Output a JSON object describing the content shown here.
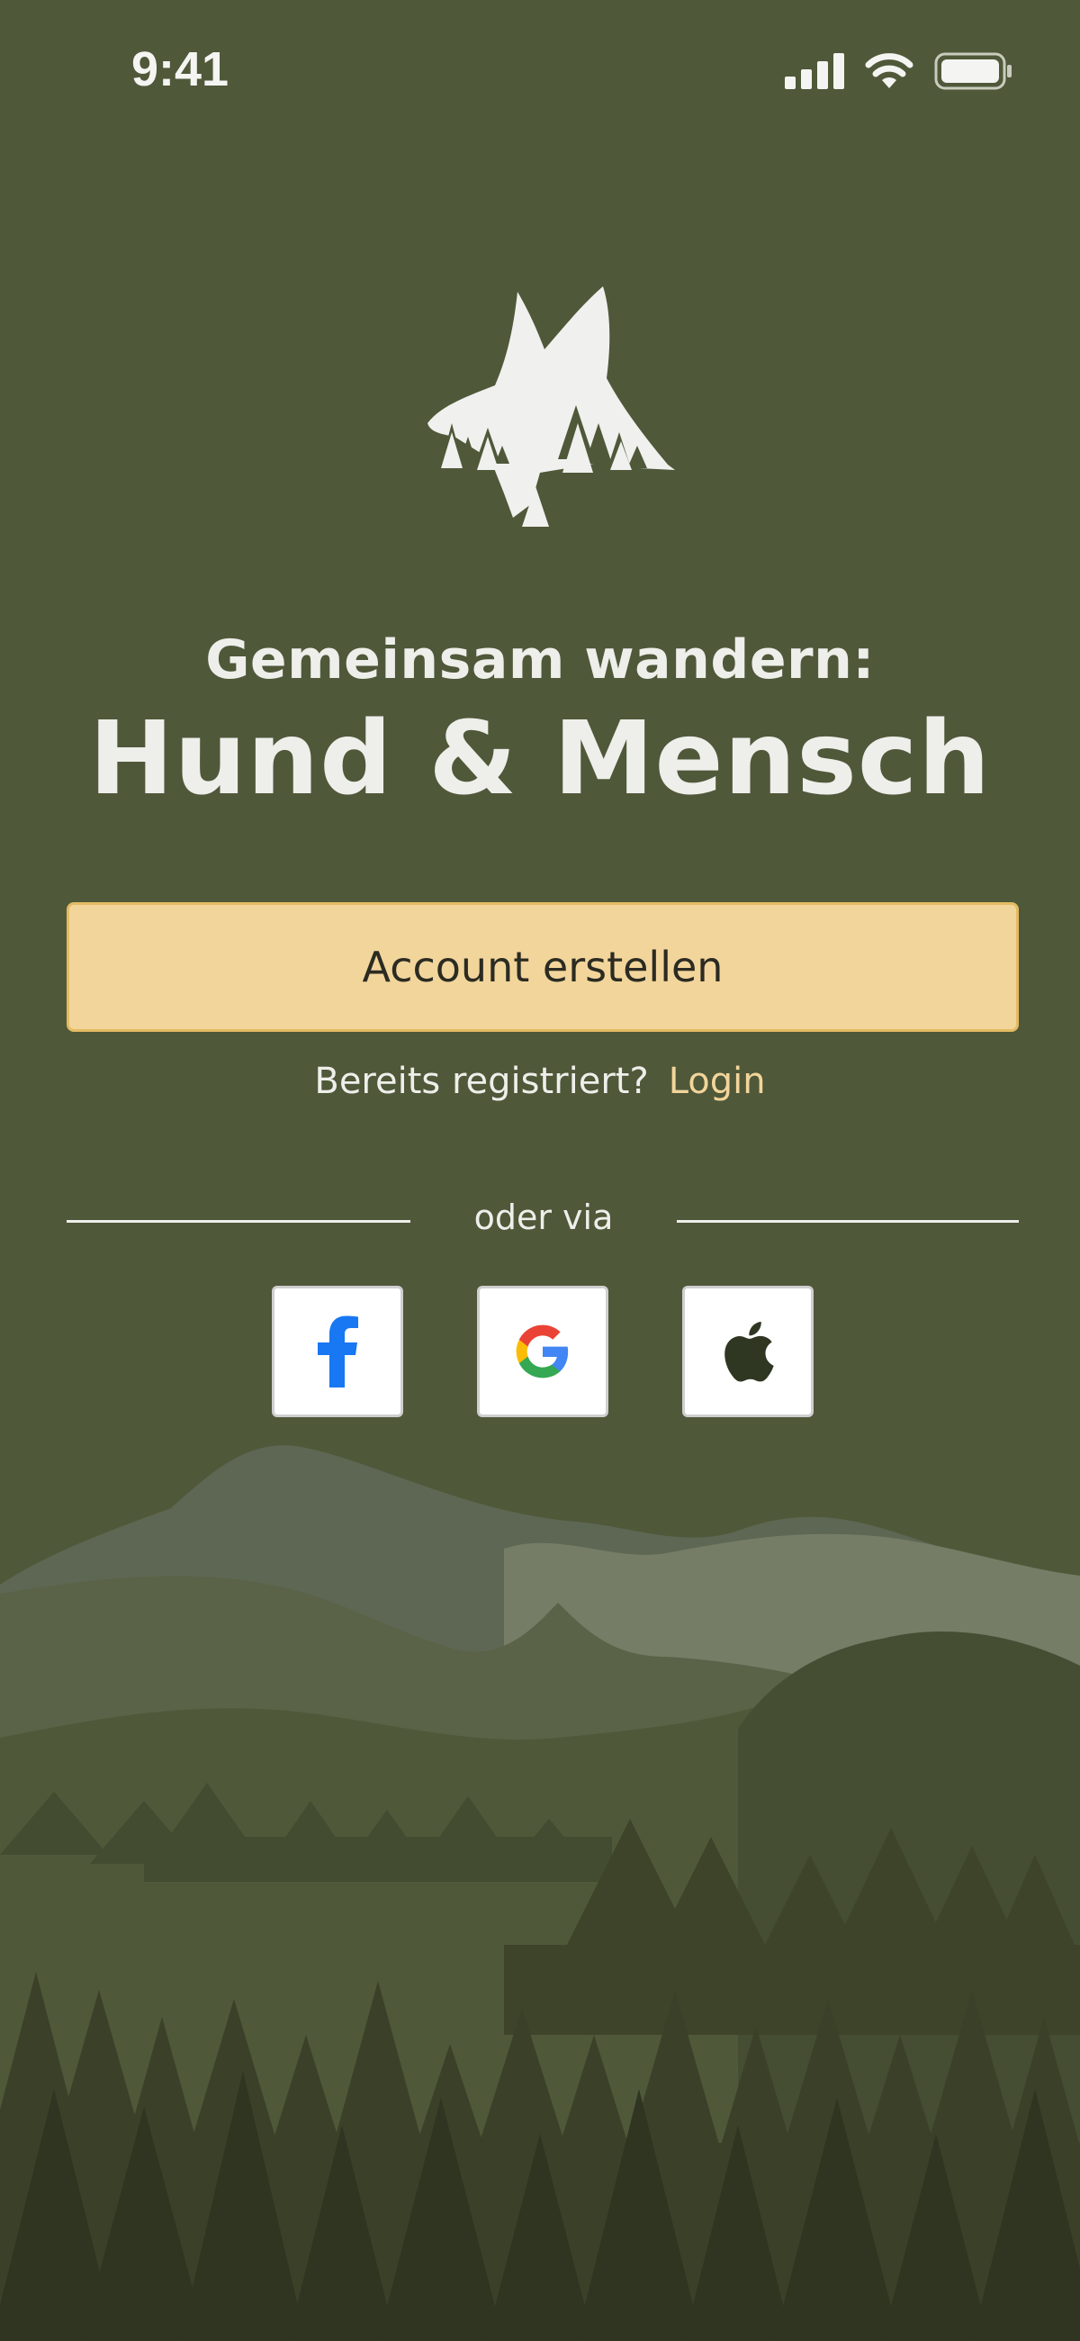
{
  "status_bar": {
    "time": "9:41",
    "icons": [
      "cellular-signal-icon",
      "wifi-icon",
      "battery-icon"
    ]
  },
  "logo": {
    "icon": "dog-head-forest-icon"
  },
  "headline": {
    "subtitle": "Gemeinsam wandern:",
    "title": "Hund & Mensch"
  },
  "cta": {
    "create_account_label": "Account erstellen"
  },
  "login": {
    "prompt": "Bereits registriert?",
    "link_label": "Login"
  },
  "divider": {
    "label": "oder via"
  },
  "social": [
    {
      "provider": "facebook",
      "icon": "facebook-icon",
      "color": "#1877f2"
    },
    {
      "provider": "google",
      "icon": "google-icon",
      "colors": [
        "#4285f4",
        "#ea4335",
        "#fbbc05",
        "#34a853"
      ]
    },
    {
      "provider": "apple",
      "icon": "apple-icon",
      "color": "#2f3622"
    }
  ],
  "colors": {
    "background": "#4f5839",
    "accent": "#f2d59b",
    "accent_border": "#e3bb63",
    "text_light": "#eeeeea"
  }
}
